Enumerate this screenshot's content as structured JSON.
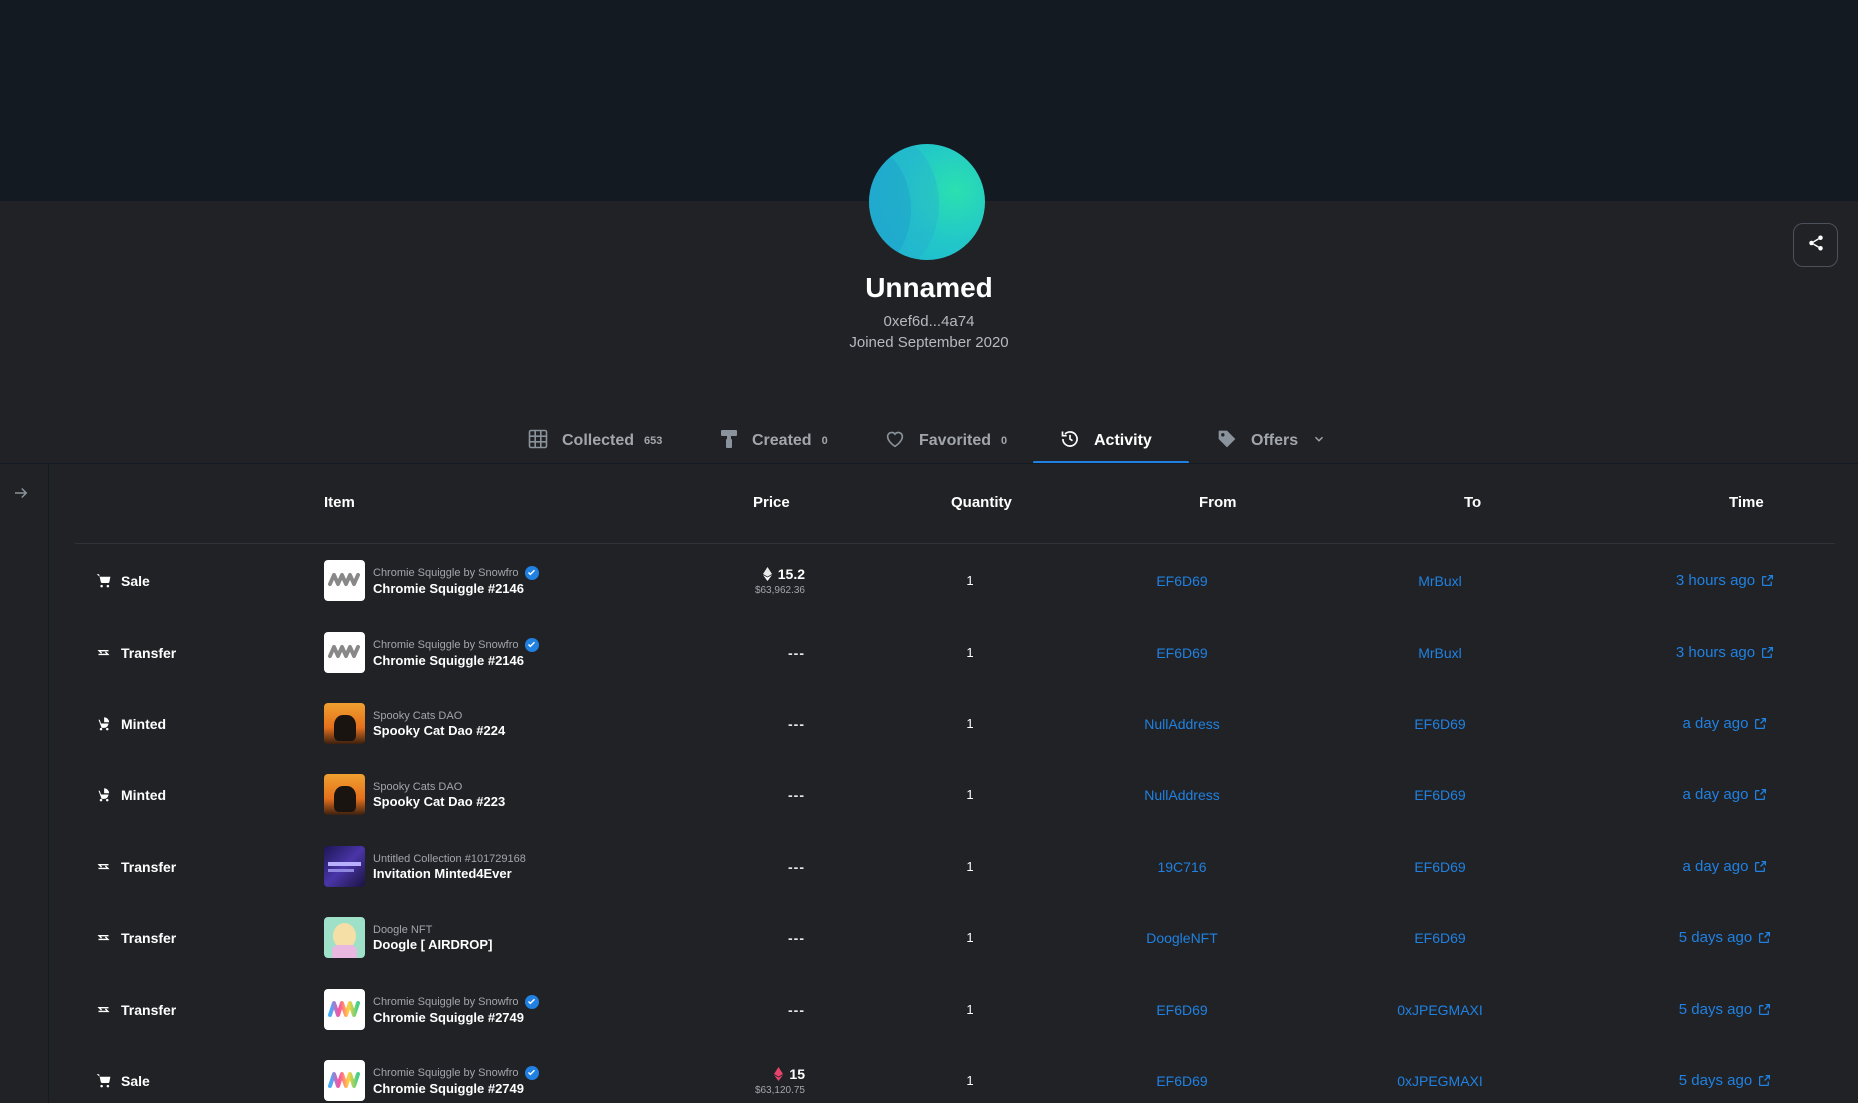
{
  "profile": {
    "name": "Unnamed",
    "address": "0xef6d...4a74",
    "joined": "Joined September 2020"
  },
  "tabs": [
    {
      "label": "Collected",
      "count": "653",
      "icon": "grid-icon"
    },
    {
      "label": "Created",
      "count": "0",
      "icon": "paintbrush-icon"
    },
    {
      "label": "Favorited",
      "count": "0",
      "icon": "heart-icon"
    },
    {
      "label": "Activity",
      "count": "",
      "icon": "history-icon",
      "active": true
    },
    {
      "label": "Offers",
      "count": "",
      "icon": "tag-icon"
    }
  ],
  "table": {
    "headers": [
      "Item",
      "Price",
      "Quantity",
      "From",
      "To",
      "Time"
    ],
    "rows": [
      {
        "event": "Sale",
        "event_icon": "cart-icon",
        "collection": "Chromie Squiggle by Snowfro",
        "verified": true,
        "item": "Chromie Squiggle #2146",
        "price": "15.2",
        "price_usd": "$63,962.36",
        "price_token": "eth",
        "quantity": "1",
        "from": "EF6D69",
        "to": "MrBuxl",
        "time": "3 hours ago"
      },
      {
        "event": "Transfer",
        "event_icon": "transfer-icon",
        "collection": "Chromie Squiggle by Snowfro",
        "verified": true,
        "item": "Chromie Squiggle #2146",
        "price": "---",
        "price_usd": "",
        "price_token": "",
        "quantity": "1",
        "from": "EF6D69",
        "to": "MrBuxl",
        "time": "3 hours ago"
      },
      {
        "event": "Minted",
        "event_icon": "stroller-icon",
        "collection": "Spooky Cats DAO",
        "verified": false,
        "item": "Spooky Cat Dao #224",
        "price": "---",
        "price_usd": "",
        "price_token": "",
        "quantity": "1",
        "from": "NullAddress",
        "to": "EF6D69",
        "time": "a day ago"
      },
      {
        "event": "Minted",
        "event_icon": "stroller-icon",
        "collection": "Spooky Cats DAO",
        "verified": false,
        "item": "Spooky Cat Dao #223",
        "price": "---",
        "price_usd": "",
        "price_token": "",
        "quantity": "1",
        "from": "NullAddress",
        "to": "EF6D69",
        "time": "a day ago"
      },
      {
        "event": "Transfer",
        "event_icon": "transfer-icon",
        "collection": "Untitled Collection #101729168",
        "verified": false,
        "item": "Invitation Minted4Ever",
        "price": "---",
        "price_usd": "",
        "price_token": "",
        "quantity": "1",
        "from": "19C716",
        "to": "EF6D69",
        "time": "a day ago"
      },
      {
        "event": "Transfer",
        "event_icon": "transfer-icon",
        "collection": "Doogle NFT",
        "verified": false,
        "item": "Doogle [ AIRDROP]",
        "price": "---",
        "price_usd": "",
        "price_token": "",
        "quantity": "1",
        "from": "DoogleNFT",
        "to": "EF6D69",
        "time": "5 days ago"
      },
      {
        "event": "Transfer",
        "event_icon": "transfer-icon",
        "collection": "Chromie Squiggle by Snowfro",
        "verified": true,
        "item": "Chromie Squiggle #2749",
        "price": "---",
        "price_usd": "",
        "price_token": "",
        "quantity": "1",
        "from": "EF6D69",
        "to": "0xJPEGMAXI",
        "time": "5 days ago"
      },
      {
        "event": "Sale",
        "event_icon": "cart-icon",
        "collection": "Chromie Squiggle by Snowfro",
        "verified": true,
        "item": "Chromie Squiggle #2749",
        "price": "15",
        "price_usd": "$63,120.75",
        "price_token": "weth",
        "quantity": "1",
        "from": "EF6D69",
        "to": "0xJPEGMAXI",
        "time": "5 days ago"
      }
    ]
  },
  "colors": {
    "link": "#2081e2",
    "background": "#202225",
    "banner": "#141a22"
  }
}
